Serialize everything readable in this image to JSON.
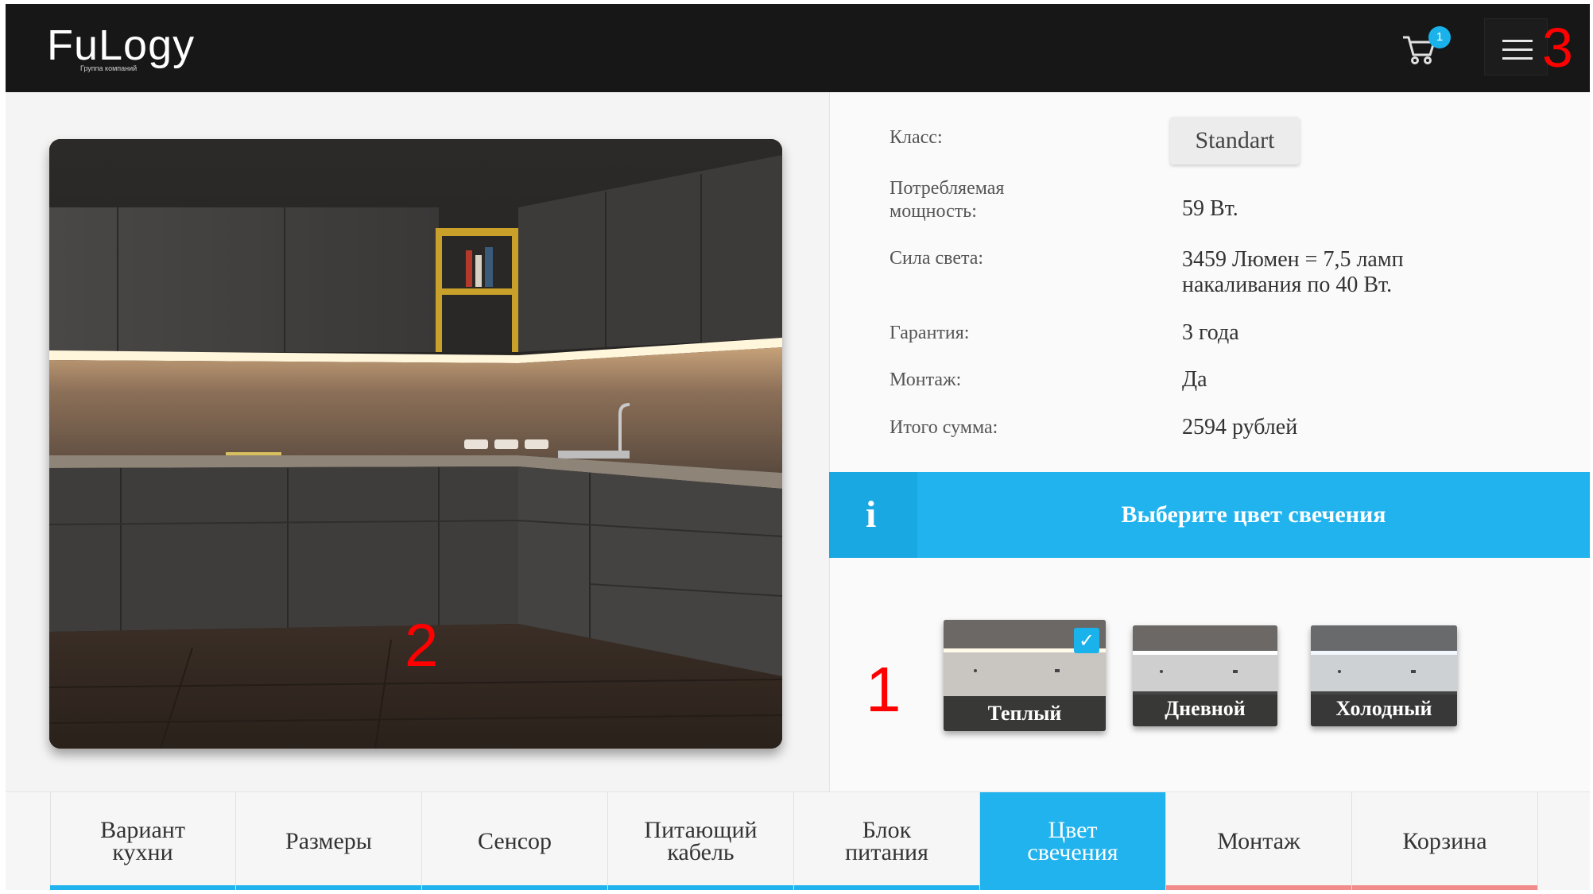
{
  "header": {
    "logo_text": "FuLogy",
    "logo_subtitle": "Группа компаний",
    "cart_count": "1"
  },
  "annotations": {
    "one": "1",
    "two": "2",
    "three": "3"
  },
  "specs": [
    {
      "label": "Класс:",
      "value": "Standart"
    },
    {
      "label": "Потребляемая\nмощность:",
      "value": "59 Вт."
    },
    {
      "label": "Сила света:",
      "value": "3459 Люмен = 7,5 ламп\nнакаливания по 40 Вт."
    },
    {
      "label": "Гарантия:",
      "value": "3 года"
    },
    {
      "label": "Монтаж:",
      "value": "Да"
    },
    {
      "label": "Итого сумма:",
      "value": "2594 рублей"
    }
  ],
  "info": {
    "icon": "i",
    "text": "Выберите цвет свечения"
  },
  "swatches": [
    {
      "label": "Теплый",
      "selected": true
    },
    {
      "label": "Дневной",
      "selected": false
    },
    {
      "label": "Холодный",
      "selected": false
    }
  ],
  "slider": {
    "slide_count": 3,
    "active_slide": 1
  },
  "tabs": [
    {
      "label": "Вариант\nкухни",
      "active": false
    },
    {
      "label": "Размеры",
      "active": false
    },
    {
      "label": "Сенсор",
      "active": false
    },
    {
      "label": "Питающий\nкабель",
      "active": false
    },
    {
      "label": "Блок\nпитания",
      "active": false
    },
    {
      "label": "Цвет\nсвечения",
      "active": true
    },
    {
      "label": "Монтаж",
      "active": false
    },
    {
      "label": "Корзина",
      "active": false
    }
  ],
  "colors": {
    "accent": "#21b3ee",
    "header_bg": "#171717",
    "annotation": "#ff0000",
    "tab_done_underline": "#21b3ee",
    "tab_pending_underline": "#f28b8b"
  }
}
